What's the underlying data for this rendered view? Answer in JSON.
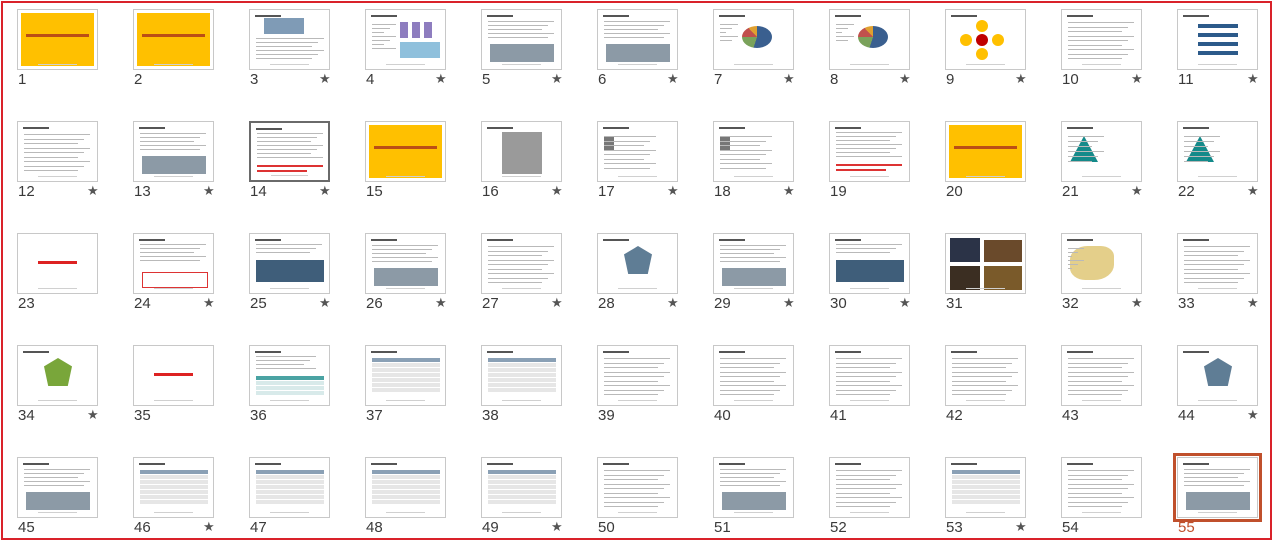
{
  "view": "Slide Sorter",
  "selected_slide": "55",
  "focused_slide": "14",
  "colors": {
    "selection_border": "#d9222a",
    "selected_thumb": "#c0502c",
    "title_slide": "#ffc000"
  },
  "slides": [
    {
      "n": "1",
      "star": "",
      "kind": "title"
    },
    {
      "n": "2",
      "star": "",
      "kind": "title"
    },
    {
      "n": "3",
      "star": "★",
      "kind": "pic-top"
    },
    {
      "n": "4",
      "star": "★",
      "kind": "chart"
    },
    {
      "n": "5",
      "star": "★",
      "kind": "pic-bottom"
    },
    {
      "n": "6",
      "star": "★",
      "kind": "pic-bottom"
    },
    {
      "n": "7",
      "star": "★",
      "kind": "pie"
    },
    {
      "n": "8",
      "star": "★",
      "kind": "pie"
    },
    {
      "n": "9",
      "star": "★",
      "kind": "circles"
    },
    {
      "n": "10",
      "star": "★",
      "kind": "text"
    },
    {
      "n": "11",
      "star": "★",
      "kind": "diagram"
    },
    {
      "n": "12",
      "star": "★",
      "kind": "text"
    },
    {
      "n": "13",
      "star": "★",
      "kind": "pic-bottom"
    },
    {
      "n": "14",
      "star": "★",
      "kind": "text-red"
    },
    {
      "n": "15",
      "star": "",
      "kind": "title"
    },
    {
      "n": "16",
      "star": "★",
      "kind": "people"
    },
    {
      "n": "17",
      "star": "★",
      "kind": "text-pic"
    },
    {
      "n": "18",
      "star": "★",
      "kind": "text-pic"
    },
    {
      "n": "19",
      "star": "",
      "kind": "text-red"
    },
    {
      "n": "20",
      "star": "",
      "kind": "title"
    },
    {
      "n": "21",
      "star": "★",
      "kind": "pyramid"
    },
    {
      "n": "22",
      "star": "★",
      "kind": "pyramid"
    },
    {
      "n": "23",
      "star": "",
      "kind": "red-title"
    },
    {
      "n": "24",
      "star": "★",
      "kind": "text-box"
    },
    {
      "n": "25",
      "star": "★",
      "kind": "pic-mid"
    },
    {
      "n": "26",
      "star": "★",
      "kind": "pic-bottom"
    },
    {
      "n": "27",
      "star": "★",
      "kind": "text"
    },
    {
      "n": "28",
      "star": "★",
      "kind": "radar"
    },
    {
      "n": "29",
      "star": "★",
      "kind": "pic-bottom"
    },
    {
      "n": "30",
      "star": "★",
      "kind": "pic-mid"
    },
    {
      "n": "31",
      "star": "",
      "kind": "photos"
    },
    {
      "n": "32",
      "star": "★",
      "kind": "map"
    },
    {
      "n": "33",
      "star": "★",
      "kind": "text"
    },
    {
      "n": "34",
      "star": "★",
      "kind": "radar-green"
    },
    {
      "n": "35",
      "star": "",
      "kind": "red-title"
    },
    {
      "n": "36",
      "star": "",
      "kind": "table-teal"
    },
    {
      "n": "37",
      "star": "",
      "kind": "table"
    },
    {
      "n": "38",
      "star": "",
      "kind": "table"
    },
    {
      "n": "39",
      "star": "",
      "kind": "text"
    },
    {
      "n": "40",
      "star": "",
      "kind": "text"
    },
    {
      "n": "41",
      "star": "",
      "kind": "text"
    },
    {
      "n": "42",
      "star": "",
      "kind": "text"
    },
    {
      "n": "43",
      "star": "",
      "kind": "text"
    },
    {
      "n": "44",
      "star": "★",
      "kind": "radar"
    },
    {
      "n": "45",
      "star": "",
      "kind": "pic-bottom"
    },
    {
      "n": "46",
      "star": "★",
      "kind": "table"
    },
    {
      "n": "47",
      "star": "",
      "kind": "table"
    },
    {
      "n": "48",
      "star": "",
      "kind": "table"
    },
    {
      "n": "49",
      "star": "★",
      "kind": "table"
    },
    {
      "n": "50",
      "star": "",
      "kind": "text"
    },
    {
      "n": "51",
      "star": "",
      "kind": "pic-bottom"
    },
    {
      "n": "52",
      "star": "",
      "kind": "text"
    },
    {
      "n": "53",
      "star": "★",
      "kind": "table"
    },
    {
      "n": "54",
      "star": "",
      "kind": "text"
    },
    {
      "n": "55",
      "star": "",
      "kind": "pic-bottom"
    }
  ]
}
